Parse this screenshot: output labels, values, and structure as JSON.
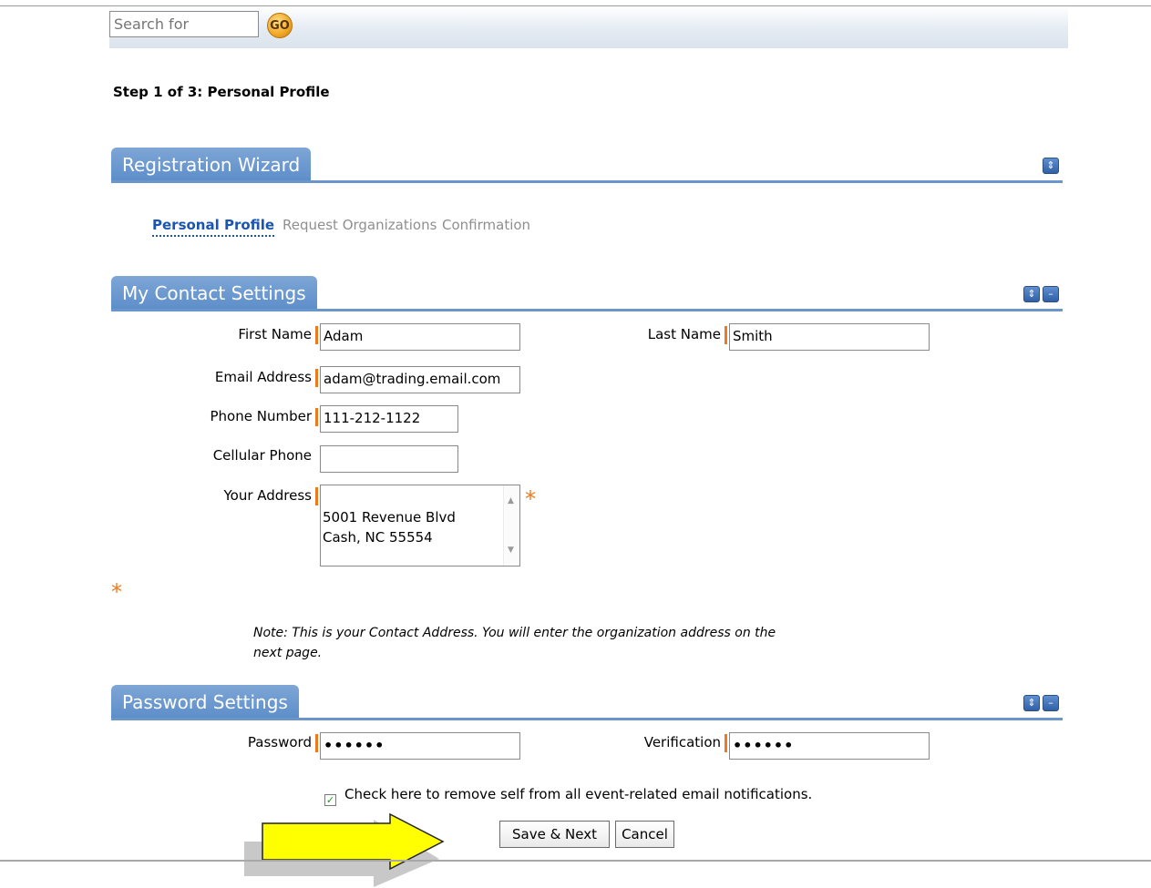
{
  "search": {
    "placeholder": "Search for",
    "go_label": "GO"
  },
  "step_title": "Step 1 of 3: Personal Profile",
  "wizard": {
    "title": "Registration Wizard",
    "steps": [
      {
        "label": "Personal Profile",
        "active": true
      },
      {
        "label": "Request Organizations",
        "active": false
      },
      {
        "label": "Confirmation",
        "active": false
      }
    ]
  },
  "contact": {
    "title": "My Contact Settings",
    "first_name": {
      "label": "First Name",
      "value": "Adam"
    },
    "last_name": {
      "label": "Last Name",
      "value": "Smith"
    },
    "email": {
      "label": "Email Address",
      "value": "adam@trading.email.com"
    },
    "phone": {
      "label": "Phone Number",
      "value": "111-212-1122"
    },
    "cell": {
      "label": "Cellular Phone",
      "value": ""
    },
    "address": {
      "label": "Your Address",
      "value": "5001 Revenue Blvd\nCash, NC 55554"
    },
    "required_marker": "*",
    "note": "Note: This is your Contact Address. You will enter the organization address on the next page."
  },
  "password": {
    "title": "Password Settings",
    "password": {
      "label": "Password",
      "value": "••••••"
    },
    "verification": {
      "label": "Verification",
      "value": "••••••"
    },
    "checkbox_label": "Check here to remove self from all event-related email notifications.",
    "checkbox_checked": true
  },
  "buttons": {
    "save_next": "Save & Next",
    "cancel": "Cancel"
  },
  "icons": {
    "scroll_up": "▲",
    "scroll_down": "▼",
    "sort": "⇕",
    "collapse": "–",
    "check": "✓"
  },
  "colors": {
    "accent": "#5c8dc9",
    "required": "#ee7a1e",
    "active_step": "#1a56b0",
    "arrow_fill": "#ffff00"
  }
}
